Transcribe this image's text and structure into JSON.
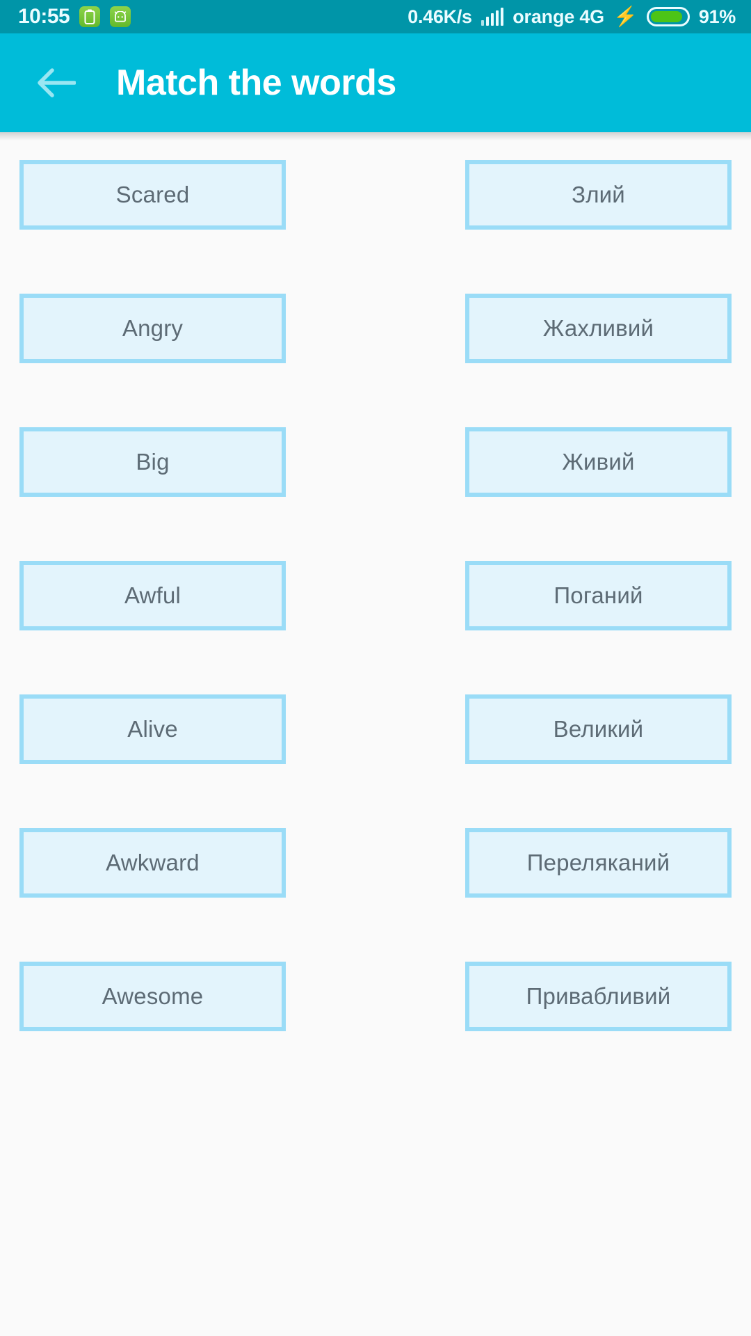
{
  "status_bar": {
    "clock": "10:55",
    "icons": [
      "battery-saver-icon",
      "android-robot-icon"
    ],
    "net_speed": "0.46K/s",
    "signal_icon": "signal-bars-icon",
    "carrier": "orange 4G",
    "charging_icon": "charging-bolt-icon",
    "battery_level": "91%",
    "background_color": "#0095a8"
  },
  "app_bar": {
    "back_icon": "back-arrow-icon",
    "title": "Match the words",
    "background_color": "#00bcd9"
  },
  "colors": {
    "page_background": "#fafafa",
    "card_fill": "#e3f4fc",
    "card_border": "#9adcf7",
    "card_text": "#5d6b75"
  },
  "match_grid": {
    "rows": [
      {
        "left": "Scared",
        "right": "Злий"
      },
      {
        "left": "Angry",
        "right": "Жахливий"
      },
      {
        "left": "Big",
        "right": "Живий"
      },
      {
        "left": "Awful",
        "right": "Поганий"
      },
      {
        "left": "Alive",
        "right": "Великий"
      },
      {
        "left": "Awkward",
        "right": "Переляканий"
      },
      {
        "left": "Awesome",
        "right": "Привабливий"
      }
    ]
  }
}
